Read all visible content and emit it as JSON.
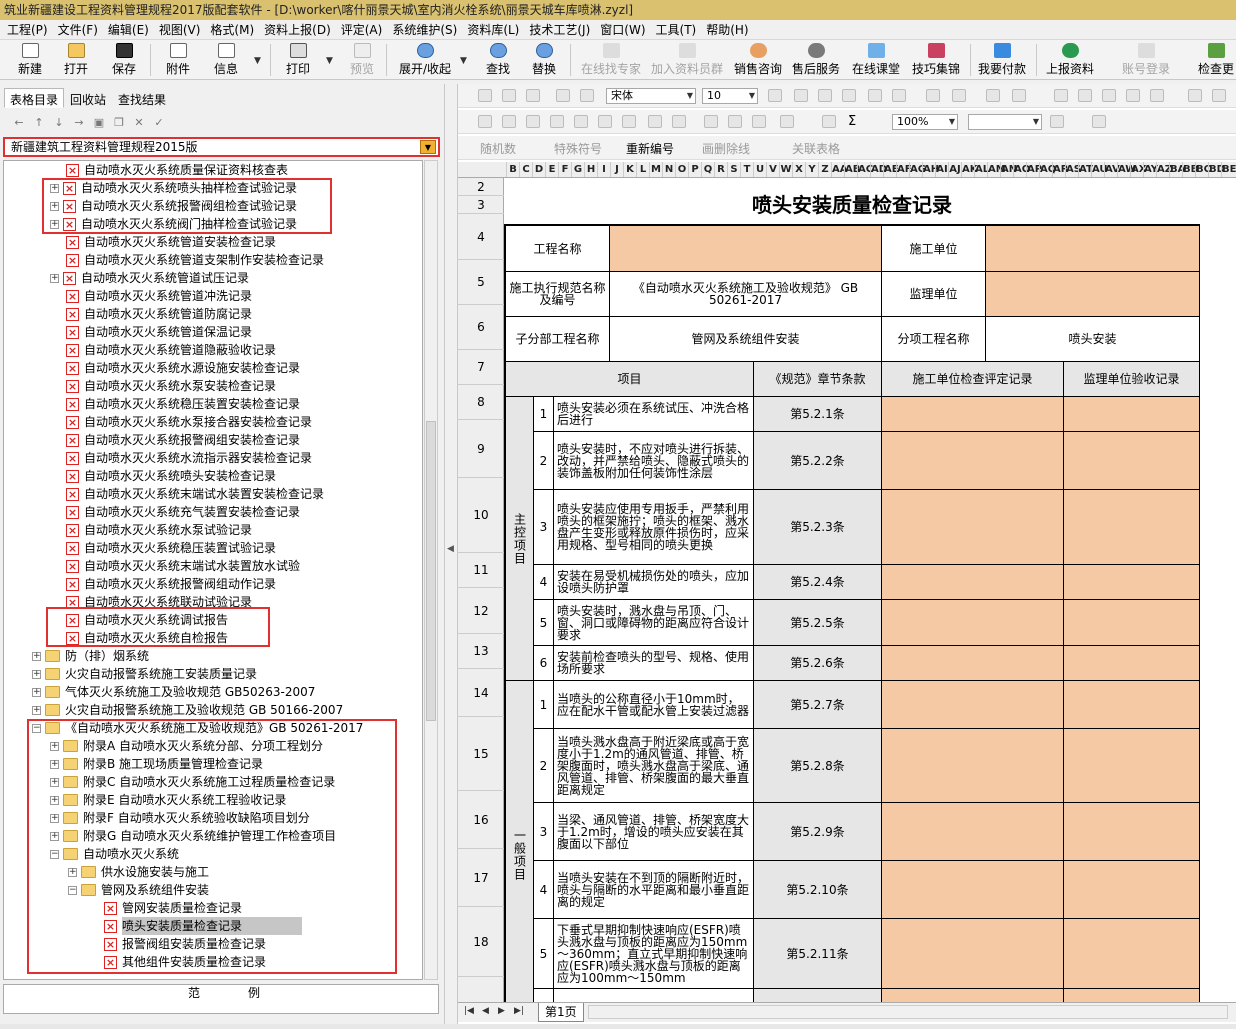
{
  "window": {
    "title": "筑业新疆建设工程资料管理规程2017版配套软件 - [D:\\worker\\喀什丽景天城\\室内消火栓系统\\丽景天城车库喷淋.zyzl]"
  },
  "menu": [
    "工程(P)",
    "文件(F)",
    "编辑(E)",
    "视图(V)",
    "格式(M)",
    "资料上报(D)",
    "评定(A)",
    "系统维护(S)",
    "资料库(L)",
    "技术工艺(J)",
    "窗口(W)",
    "工具(T)",
    "帮助(H)"
  ],
  "toolbar": {
    "new": "新建",
    "open": "打开",
    "save": "保存",
    "attach": "附件",
    "info": "信息",
    "print": "打印",
    "preview": "预览",
    "expand": "展开/收起",
    "find": "查找",
    "replace": "替换",
    "online_expert": "在线找专家",
    "join_writer": "加入资料员群",
    "sales": "销售咨询",
    "after_sales": "售后服务",
    "online_class": "在线课堂",
    "tips": "技巧集锦",
    "pay": "我要付款",
    "upload": "上报资料",
    "login": "账号登录",
    "check": "检查更"
  },
  "left_tabs": [
    "表格目录",
    "回收站",
    "查找结果"
  ],
  "spec_combo": "新疆建筑工程资料管理规程2015版",
  "tree": [
    "自动喷水灭火系统质量保证资料核查表",
    "自动喷水灭火系统喷头抽样检查试验记录",
    "自动喷水灭火系统报警阀组检查试验记录",
    "自动喷水灭火系统阀门抽样检查试验记录",
    "自动喷水灭火系统管道安装检查记录",
    "自动喷水灭火系统管道支架制作安装检查记录",
    "自动喷水灭火系统管道试压记录",
    "自动喷水灭火系统管道冲洗记录",
    "自动喷水灭火系统管道防腐记录",
    "自动喷水灭火系统管道保温记录",
    "自动喷水灭火系统管道隐蔽验收记录",
    "自动喷水灭火系统水源设施安装检查记录",
    "自动喷水灭火系统水泵安装检查记录",
    "自动喷水灭火系统稳压装置安装检查记录",
    "自动喷水灭火系统水泵接合器安装检查记录",
    "自动喷水灭火系统报警阀组安装检查记录",
    "自动喷水灭火系统水流指示器安装检查记录",
    "自动喷水灭火系统喷头安装检查记录",
    "自动喷水灭火系统末端试水装置安装检查记录",
    "自动喷水灭火系统充气装置安装检查记录",
    "自动喷水灭火系统水泵试验记录",
    "自动喷水灭火系统稳压装置试验记录",
    "自动喷水灭火系统末端试水装置放水试验",
    "自动喷水灭火系统报警阀组动作记录",
    "自动喷水灭火系统联动试验记录",
    "自动喷水灭火系统调试报告",
    "自动喷水灭火系统自检报告",
    "防（排）烟系统",
    "火灾自动报警系统施工安装质量记录",
    "气体灭火系统施工及验收规范 GB50263-2007",
    "火灾自动报警系统施工及验收规范 GB 50166-2007",
    "《自动喷水灭火系统施工及验收规范》GB 50261-2017",
    "附录A 自动喷水灭火系统分部、分项工程划分",
    "附录B 施工现场质量管理检查记录",
    "附录C 自动喷水灭火系统施工过程质量检查记录",
    "附录E 自动喷水灭火系统工程验收记录",
    "附录F 自动喷水灭火系统验收缺陷项目划分",
    "附录G 自动喷水灭火系统维护管理工作检查项目",
    "自动喷水灭火系统",
    "供水设施安装与施工",
    "管网及系统组件安装",
    "管网安装质量检查记录",
    "喷头安装质量检查记录",
    "报警阀组安装质量检查记录",
    "其他组件安装质量检查记录"
  ],
  "legend": {
    "a": "范",
    "b": "例"
  },
  "format_bar": {
    "font": "宋体",
    "size": "10",
    "zoom": "100%",
    "random": "随机数",
    "special": "特殊符号",
    "renumber": "重新编号",
    "delete_line": "画删除线",
    "linked": "关联表格"
  },
  "columns": "BCDEFGHIJKLMNOPQRSTUVWXYZAAABACADAEAFAGAHAIAJAKALAMANAOAPAQARASATAUAVAWAXAYAZBABBBCBDBE",
  "rows": [
    "2",
    "3",
    "4",
    "5",
    "6",
    "7",
    "8",
    "9",
    "10",
    "11",
    "12",
    "13",
    "14",
    "15",
    "16",
    "17",
    "18"
  ],
  "form": {
    "title": "喷头安装质量检查记录",
    "project_name_label": "工程名称",
    "construction_unit_label": "施工单位",
    "spec_label": "施工执行规范名称及编号",
    "spec_value": "《自动喷水灭火系统施工及验收规范》 GB 50261-2017",
    "supervision_unit_label": "监理单位",
    "sub_project_label": "子分部工程名称",
    "sub_project_value": "管网及系统组件安装",
    "item_project_label": "分项工程名称",
    "item_project_value": "喷头安装",
    "col_item": "项目",
    "col_clause": "《规范》章节条款",
    "col_construction": "施工单位检查评定记录",
    "col_supervision": "监理单位验收记录",
    "main_label": "主控项目",
    "general_label": "一般项目",
    "main_items": [
      {
        "no": "1",
        "text": "喷头安装必须在系统试压、冲洗合格后进行",
        "clause": "第5.2.1条"
      },
      {
        "no": "2",
        "text": "喷头安装时，不应对喷头进行拆装、改动，并严禁给喷头、隐蔽式喷头的装饰盖板附加任何装饰性涂层",
        "clause": "第5.2.2条"
      },
      {
        "no": "3",
        "text": "喷头安装应使用专用扳手，严禁利用喷头的框架施拧；喷头的框架、溅水盘产生变形或释放原件损伤时，应采用规格、型号相同的喷头更换",
        "clause": "第5.2.3条"
      },
      {
        "no": "4",
        "text": "安装在易受机械损伤处的喷头，应加设喷头防护罩",
        "clause": "第5.2.4条"
      },
      {
        "no": "5",
        "text": "喷头安装时，溅水盘与吊顶、门、窗、洞口或障碍物的距离应符合设计要求",
        "clause": "第5.2.5条"
      },
      {
        "no": "6",
        "text": "安装前检查喷头的型号、规格、使用场所要求",
        "clause": "第5.2.6条"
      }
    ],
    "general_items": [
      {
        "no": "1",
        "text": "当喷头的公称直径小于10mm时，应在配水干管或配水管上安装过滤器",
        "clause": "第5.2.7条"
      },
      {
        "no": "2",
        "text": "当喷头溅水盘高于附近梁底或高于宽度小于1.2m的通风管道、排管、桥架腹面时，喷头溅水盘高于梁底、通风管道、排管、桥架腹面的最大垂直距离规定",
        "clause": "第5.2.8条"
      },
      {
        "no": "3",
        "text": "当梁、通风管道、排管、桥架宽度大于1.2m时，增设的喷头应安装在其腹面以下部位",
        "clause": "第5.2.9条"
      },
      {
        "no": "4",
        "text": "当喷头安装在不到顶的隔断附近时，喷头与隔断的水平距离和最小垂直距离的规定",
        "clause": "第5.2.10条"
      },
      {
        "no": "5",
        "text": "下垂式早期抑制快速响应(ESFR)喷头溅水盘与顶板的距离应为150mm～360mm；直立式早期抑制快速响应(ESFR)喷头溅水盘与顶板的距离应为100mm～150mm",
        "clause": "第5.2.11条"
      },
      {
        "no": "6",
        "text": "顶板处的障碍物与任何喷头的相",
        "clause": ""
      }
    ]
  },
  "sheet_tab": "第1页",
  "colors": {
    "title_bar": "#d9c170",
    "input_fill": "#f6c9a5",
    "highlight_box": "#e03030"
  }
}
